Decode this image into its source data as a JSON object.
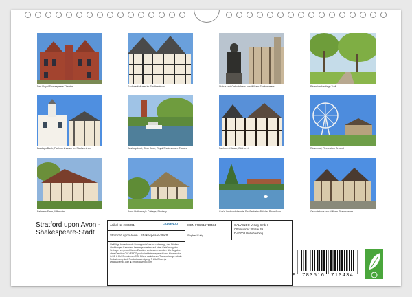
{
  "photos": [
    {
      "caption": "Das Royal Shakespeare Theatre"
    },
    {
      "caption": "Fachwerkhäuser im Stadtzentrum"
    },
    {
      "caption": "Statue und Geburtshaus von William Shakespeare"
    },
    {
      "caption": "Riverside Heritage Trail"
    },
    {
      "caption": "Barclays Bank, Fachwerkhäuser im Stadtzentrum"
    },
    {
      "caption": "Ausflugsboot, River Avon, Royal Shakespeare Theatre"
    },
    {
      "caption": "Fachwerkhäuser, Bücherei"
    },
    {
      "caption": "Riesenrad, Recreation Ground"
    },
    {
      "caption": "Palmer's Farm, Wilmcote"
    },
    {
      "caption": "Anne Hathaway's Cottage, Shottery"
    },
    {
      "caption": "Cox's Yard und die alte Straßenbahn-Brücke, River Avon"
    },
    {
      "caption": "Geburtshaus von William Shakespeare"
    }
  ],
  "title": "Stratford upon Avon - Shakespeare-Stadt",
  "info": {
    "article": "Artikel-Nr. 2186091",
    "isbn": "ISBN 9783516710434",
    "publisher_lines": [
      "CALVENDO Verlag GmbH",
      "Ottobrunner Straße 39",
      "D-82008 Unterhaching"
    ],
    "logo_text": "CALVENDO",
    "subtitle": "Stratford upon Avon - Shakespeare-Stadt",
    "author": "Siegfried Kuttig",
    "description": "Vielfältige bezaubernde Schnappschüsse ins unbewegt, des Städtes, Abbildungen Kalenders herausgearbeiten und einer Gebührung des Vertrages zu gewerblichen Zwecken weiterzuverwenden. Alle Angaben ohne Gewähr. CALVENDO produziert betriebsgerecht und klimaneutral in DE & EU. Emissionen CO2 Bilanz dank kurzer Transportwege. Abfall-Reduzierung dank Produktionsfertigung. © Alle Bilder: ▶ www.calvendo.com ▶ info@calvendo.com"
  },
  "barcode": {
    "digits": [
      "9",
      "783516",
      "710434"
    ]
  },
  "colors": {
    "eco_green": "#4aa63c",
    "sky": "#5b94d6"
  }
}
